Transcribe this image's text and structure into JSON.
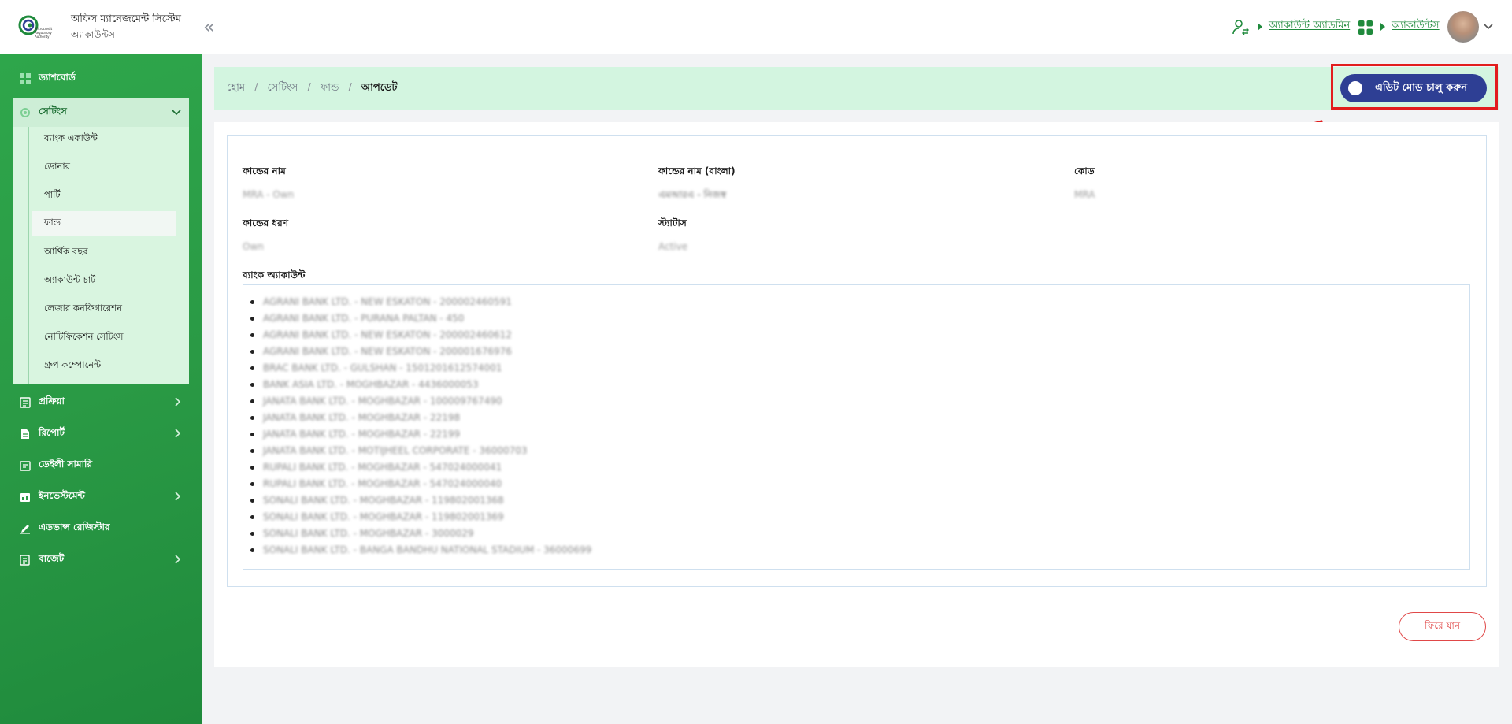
{
  "header": {
    "app_title": "অফিস ম্যানেজমেন্ট সিস্টেম",
    "app_subtitle": "অ্যাকাউন্টস",
    "collapse_glyph": "«",
    "user_role_label": "অ্যাকাউন্ট অ্যাডমিন",
    "module_label": "অ্যাকাউন্টস",
    "logo_text": "Microcredit Regulatory Authority",
    "accent": "#1f8a3c"
  },
  "sidebar": {
    "dashboard": "ড্যাশবোর্ড",
    "settings": "সেটিংস",
    "settings_items": [
      "ব্যাংক একাউন্ট",
      "ডোনার",
      "পার্টি",
      "ফান্ড",
      "আর্থিক বছর",
      "অ্যাকাউন্ট চার্ট",
      "লেজার কনফিগারেশন",
      "নোটিফিকেশন সেটিংস",
      "গ্রুপ কম্পোনেন্ট"
    ],
    "active_item": "ফান্ড",
    "process": "প্রক্রিয়া",
    "report": "রিপোর্ট",
    "daily_summary": "ডেইলী সামারি",
    "investment": "ইনভেস্টমেন্ট",
    "advance_register": "এডভান্স রেজিস্টার",
    "budget": "বাজেট"
  },
  "breadcrumb": {
    "home": "হোম",
    "settings": "সেটিংস",
    "fund": "ফান্ড",
    "current": "আপডেট",
    "separator": "/"
  },
  "edit_mode_button": "এডিট মোড চালু করুন",
  "form": {
    "fund_name_label": "ফান্ডের নাম",
    "fund_name_value": "MRA - Own",
    "fund_name_bn_label": "ফান্ডের নাম (বাংলা)",
    "fund_name_bn_value": "এমআরএ - নিজস্ব",
    "code_label": "কোড",
    "code_value": "MRA",
    "fund_type_label": "ফান্ডের ধরণ",
    "fund_type_value": "Own",
    "status_label": "স্ট্যাটাস",
    "status_value": "Active",
    "bank_account_label": "ব্যাংক অ্যাকাউন্ট",
    "bank_accounts": [
      "AGRANI BANK LTD. - NEW ESKATON - 200002460591",
      "AGRANI BANK LTD. - PURANA PALTAN - 450",
      "AGRANI BANK LTD. - NEW ESKATON - 200002460612",
      "AGRANI BANK LTD. - NEW ESKATON - 200001676976",
      "BRAC BANK LTD. - GULSHAN - 1501201612574001",
      "BANK ASIA LTD. - MOGHBAZAR - 4436000053",
      "JANATA BANK LTD. - MOGHBAZAR - 100009767490",
      "JANATA BANK LTD. - MOGHBAZAR - 22198",
      "JANATA BANK LTD. - MOGHBAZAR - 22199",
      "JANATA BANK LTD. - MOTIJHEEL CORPORATE - 36000703",
      "RUPALI BANK LTD. - MOGHBAZAR - 547024000041",
      "RUPALI BANK LTD. - MOGHBAZAR - 547024000040",
      "SONALI BANK LTD. - MOGHBAZAR - 119802001368",
      "SONALI BANK LTD. - MOGHBAZAR - 119802001369",
      "SONALI BANK LTD. - MOGHBAZAR - 3000029",
      "SONALI BANK LTD. - BANGA BANDHU NATIONAL STADIUM - 36000699"
    ]
  },
  "back_button": "ফিরে যান"
}
